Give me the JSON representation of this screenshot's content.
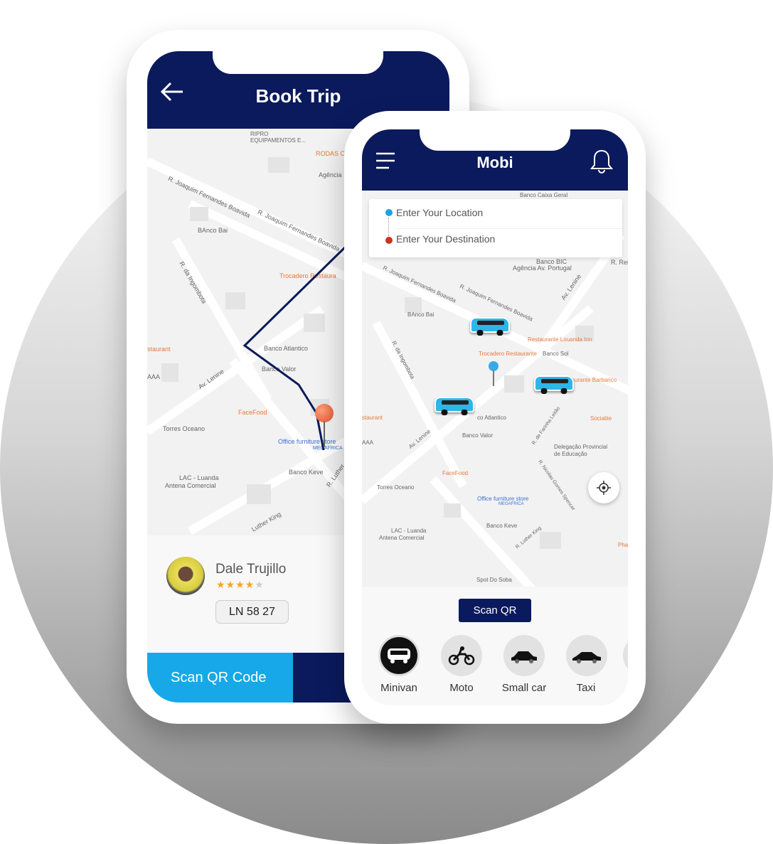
{
  "colors": {
    "navy": "#0a1a5c",
    "cyan": "#16a8e8",
    "star": "#f5a623",
    "location_dot": "#1aa3ec",
    "destination_dot": "#d0311f"
  },
  "book_trip": {
    "title": "Book Trip",
    "map_labels": [
      "RIPRO",
      "EQUIPAMENTOS E...",
      "RODAS C",
      "Agência",
      "R. Joaquim Fernandes Boavida",
      "R. Joaquim Fernandes Boavida",
      "BAnco Bai",
      "Trocadero Restaura",
      "R. da Ingombota",
      "Banco Atlantico",
      "Banco Valor",
      "staurant",
      "AAA",
      "Av. Lenine",
      "FaceFood",
      "Torres Oceano",
      "Office furniture store",
      "MEGAFRICA",
      "Banco Keve",
      "LAC - Luanda",
      "Antena Comercial",
      "Luther King",
      "R. Luther"
    ],
    "driver": {
      "name": "Dale Trujillo",
      "rating": 4,
      "rating_max": 5,
      "plate": "LN 58 27"
    },
    "scan_button": "Scan QR Code"
  },
  "mobi": {
    "title": "Mobi",
    "location_placeholder": "Enter Your Location",
    "destination_placeholder": "Enter Your Destination",
    "map_labels": [
      "Banco Caixa Geral",
      "Banco BIC",
      "Agência Av. Portugal",
      "R. Rei K",
      "R. Joaquim Fernandes Boavida",
      "R. Joaquim Fernandes Boavida",
      "Av. Lenine",
      "BAnco Bai",
      "Restaurante Louanda Inn",
      "Trocadero Restaurante",
      "Banco Sol",
      "R. da Ingombota",
      "Restaurante Barbarico",
      "co Atlantico",
      "staurant",
      "Banco Valor",
      "Socialite",
      "AAA",
      "Av. Lenine",
      "R. de Farinha Leitão",
      "Delegação Provincial",
      "de Educação",
      "FaceFood",
      "Torres Oceano",
      "R. Nicolau Gomes Spencer",
      "Office furniture store",
      "MEGAFRICA",
      "Banco Keve",
      "R. Luther King",
      "LAC - Luanda",
      "Antena Comercial",
      "Spot Do Soba",
      "Pha"
    ],
    "scan_button": "Scan QR",
    "vehicles": [
      {
        "label": "Minivan",
        "icon": "minivan-icon",
        "selected": true
      },
      {
        "label": "Moto",
        "icon": "moto-icon"
      },
      {
        "label": "Small car",
        "icon": "small-car-icon"
      },
      {
        "label": "Taxi",
        "icon": "taxi-icon"
      }
    ]
  }
}
